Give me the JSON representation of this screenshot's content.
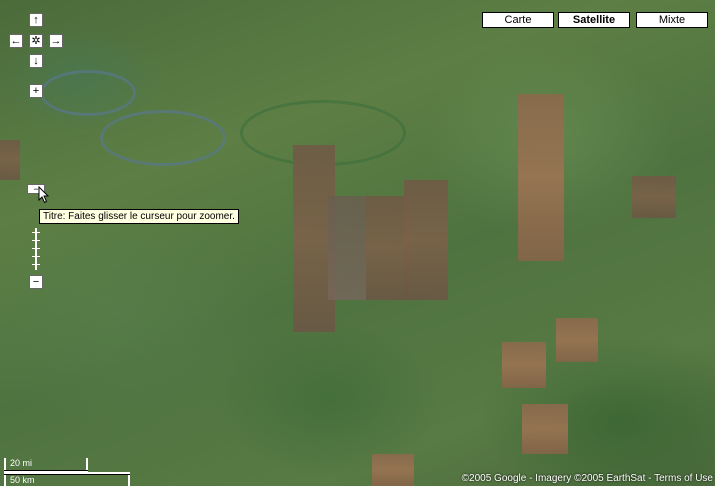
{
  "map_type": {
    "map_label": "Carte",
    "satellite_label": "Satellite",
    "hybrid_label": "Mixte",
    "selected": "Satellite"
  },
  "controls": {
    "pan_up": "↑",
    "pan_down": "↓",
    "pan_left": "←",
    "pan_right": "→",
    "pan_center": "✲",
    "zoom_in": "+",
    "zoom_out": "−",
    "slider_handle": "−"
  },
  "tooltip": {
    "text": "Titre: Faites glisser le curseur pour zoomer."
  },
  "scale": {
    "imperial": "20 mi",
    "metric": "50 km"
  },
  "copyright": "©2005 Google - Imagery ©2005 EarthSat - Terms of Use"
}
